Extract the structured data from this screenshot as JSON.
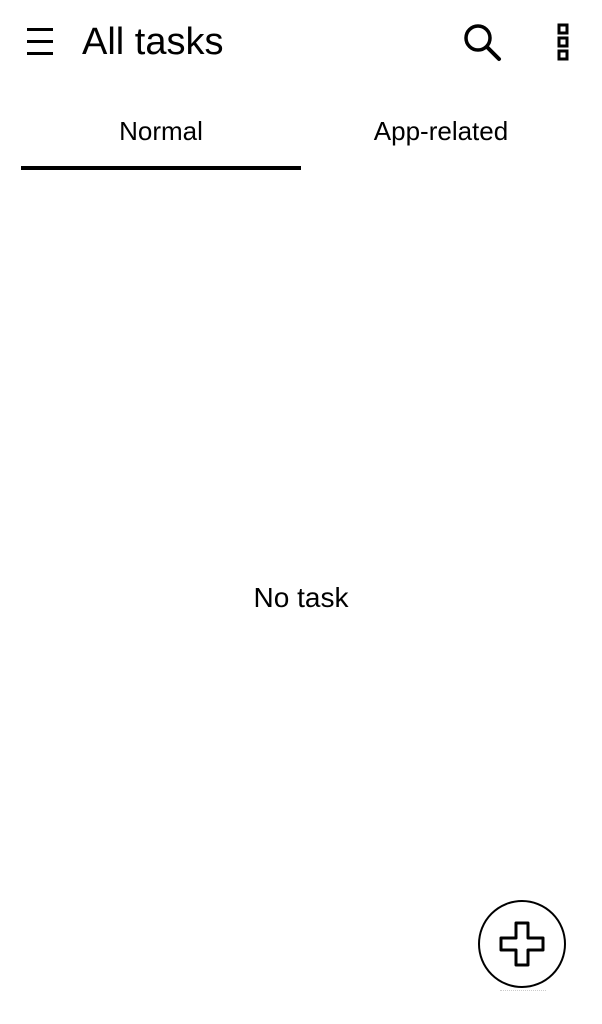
{
  "app_bar": {
    "title": "All tasks",
    "menu_icon": "hamburger-menu-icon",
    "search_icon": "search-icon",
    "overflow_icon": "more-vertical-icon"
  },
  "tabs": [
    {
      "label": "Normal",
      "selected": true
    },
    {
      "label": "App-related",
      "selected": false
    }
  ],
  "empty_state": {
    "message": "No task"
  },
  "fab": {
    "icon": "plus-icon"
  },
  "colors": {
    "foreground": "#000000",
    "background": "#ffffff"
  }
}
